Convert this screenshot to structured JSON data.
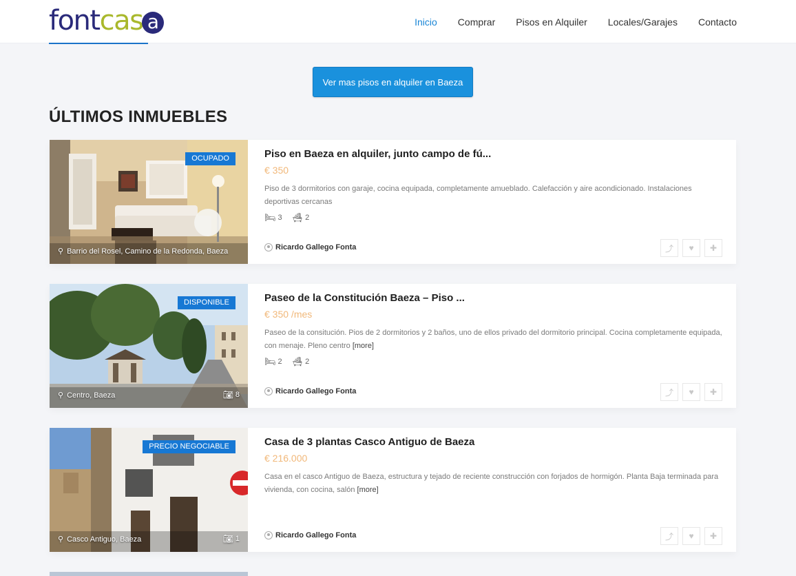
{
  "header": {
    "logo": {
      "part1": "font",
      "part2": "cas",
      "part3": "a"
    },
    "nav": [
      "Inicio",
      "Comprar",
      "Pisos en Alquiler",
      "Locales/Garajes",
      "Contacto"
    ],
    "active_index": 0
  },
  "cta": {
    "label": "Ver mas pisos en alquiler en Baeza"
  },
  "section": {
    "title": "ÚLTIMOS INMUEBLES"
  },
  "listings": [
    {
      "badge": "OCUPADO",
      "location": "Barrio del Rosel, Camino de la Redonda, Baeza",
      "photo_count": "",
      "title": "Piso en Baeza en alquiler, junto campo de fú...",
      "price": "€ 350",
      "description": "Piso de 3 dormitorios con garaje, cocina equipada, completamente amueblado. Calefacción y aire acondicionado. Instalaciones deportivas cercanas",
      "more": "",
      "beds": "3",
      "baths": "2",
      "agent": "Ricardo Gallego Fonta"
    },
    {
      "badge": "DISPONIBLE",
      "location": "Centro, Baeza",
      "photo_count": "8",
      "title": "Paseo de la Constitución Baeza – Piso ...",
      "price": "€ 350 /mes",
      "description": "Paseo de la consitución. Pios de 2 dormitorios y 2 baños, uno de ellos privado del dormitorio principal. Cocina completamente equipada, con menaje. Pleno centro",
      "more": "[more]",
      "beds": "2",
      "baths": "2",
      "agent": "Ricardo Gallego Fonta"
    },
    {
      "badge": "PRECIO NEGOCIABLE",
      "location": "Casco Antiguo, Baeza",
      "photo_count": "1",
      "title": "Casa de 3 plantas Casco Antiguo de Baeza",
      "price": "€ 216.000",
      "description": "Casa en el casco Antiguo de Baeza, estructura y tejado de reciente construcción con forjados de hormigón. Planta Baja terminada para vivienda, con cocina, salón",
      "more": "[more]",
      "beds": "",
      "baths": "",
      "agent": "Ricardo Gallego Fonta"
    }
  ],
  "icons": {
    "pin": "map-pin-icon",
    "camera": "camera-icon",
    "bed": "bed-icon",
    "bath": "bath-icon",
    "share": "share-icon",
    "heart": "heart-icon",
    "plus": "plus-icon"
  },
  "colors": {
    "brand_navy": "#2a2a7a",
    "brand_green": "#a9b82c",
    "accent_blue": "#1a91dd",
    "badge_blue": "#1778d4",
    "price_orange": "#f1b87a"
  }
}
